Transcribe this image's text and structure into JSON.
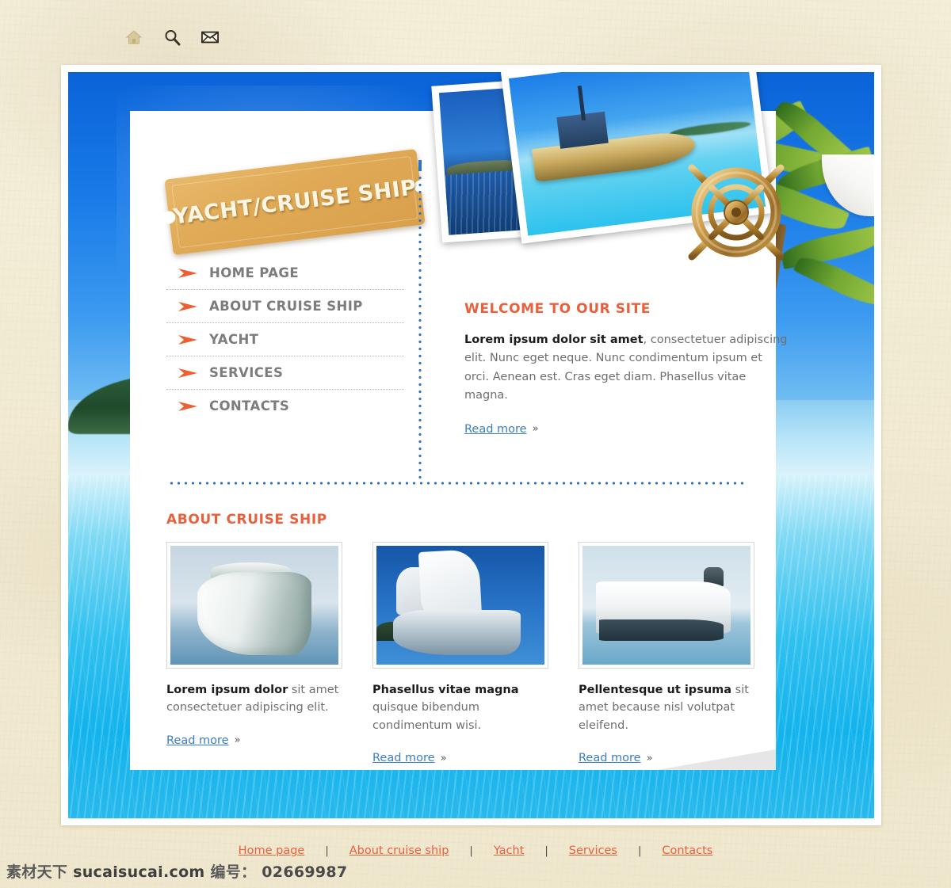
{
  "toolbar": {
    "icons": [
      {
        "name": "home-icon",
        "label": "Home"
      },
      {
        "name": "search-icon",
        "label": "Search"
      },
      {
        "name": "mail-icon",
        "label": "Mail"
      }
    ]
  },
  "brand": {
    "logo_text": "YACHT/CRUISE SHIP"
  },
  "menu": {
    "items": [
      {
        "label": "HOME PAGE"
      },
      {
        "label": "ABOUT CRUISE SHIP"
      },
      {
        "label": "YACHT"
      },
      {
        "label": "SERVICES"
      },
      {
        "label": "CONTACTS"
      }
    ]
  },
  "welcome": {
    "title": "WELCOME TO OUR SITE",
    "lead": "Lorem ipsum dolor sit amet",
    "body": ", consectetuer adipiscing elit. Nunc eget neque. Nunc condimentum ipsum et orci. Aenean est. Cras eget diam. Phasellus vitae magna.",
    "read_more": "Read more",
    "read_more_arrow": "»"
  },
  "about": {
    "title": "ABOUT CRUISE SHIP",
    "columns": [
      {
        "image_name": "cruise-ship-bow-photo",
        "lead": "Lorem ipsum dolor",
        "body": " sit amet consectetuer adipiscing elit.",
        "read_more": "Read more",
        "read_more_arrow": "»"
      },
      {
        "image_name": "sailing-ship-photo",
        "lead": "Phasellus vitae magna",
        "body": " quisque bibendum condimentum wisi.",
        "read_more": "Read more",
        "read_more_arrow": "»"
      },
      {
        "image_name": "cruise-liner-photo",
        "lead": "Pellentesque ut ipsuma",
        "body": " sit amet because nisl volutpat eleifend.",
        "read_more": "Read more",
        "read_more_arrow": "»"
      }
    ]
  },
  "footer": {
    "links": [
      {
        "label": "Home page"
      },
      {
        "label": "About cruise ship"
      },
      {
        "label": "Yacht"
      },
      {
        "label": "Services"
      },
      {
        "label": "Contacts"
      }
    ],
    "separator": "|"
  },
  "watermark": {
    "site_cn": "素材天下",
    "domain": "sucaisucai.com",
    "id_label": "编号：",
    "id_value": "02669987"
  },
  "colors": {
    "accent_orange": "#E8603C",
    "link_blue": "#3A7EC4",
    "menu_gray": "#7C7C7C",
    "ticket_gold": "#DFA955",
    "parchment": "#F2EBD4",
    "dotted_blue": "#2F74C4"
  }
}
